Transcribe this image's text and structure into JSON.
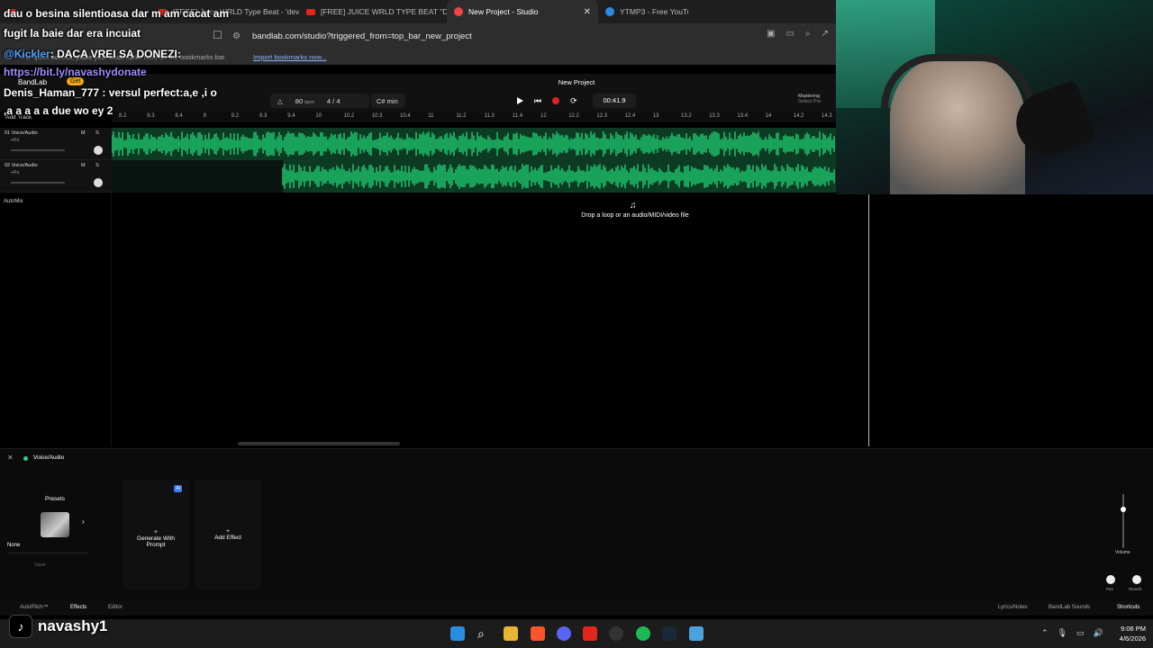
{
  "browser": {
    "tabs": [
      {
        "label": "[FREE] Juice WRLD Type Beat - 'devil",
        "type": "youtube"
      },
      {
        "label": "[FREE] JUICE WRLD TYPE BEAT \"DRUM",
        "type": "youtube"
      },
      {
        "label": "New Project - Studio",
        "type": "bandlab",
        "active": true
      },
      {
        "label": "YTMP3 - Free YouTube",
        "type": "web"
      }
    ],
    "url": "bandlab.com/studio?triggered_from=top_bar_new_project",
    "bookmarks_msg": "For quick access, place your bookmarks here on the bookmarks bar.",
    "import_bookmarks": "Import bookmarks now..."
  },
  "studio": {
    "logo": "BandLab",
    "get_badge": "Get",
    "project_title": "New Project",
    "bpm": "80",
    "bpm_unit": "bpm",
    "time_signature": "4 / 4",
    "key": "C# min",
    "time": "00:41.9",
    "mastering": "Mastering",
    "mastering_sub": "Select Pre",
    "add_track": "Add Track",
    "ruler": [
      "8.2",
      "8.3",
      "8.4",
      "9",
      "9.2",
      "9.3",
      "9.4",
      "10",
      "10.2",
      "10.3",
      "10.4",
      "11",
      "11.2",
      "11.3",
      "11.4",
      "12",
      "12.2",
      "12.3",
      "12.4",
      "13",
      "13.2",
      "13.3",
      "13.4",
      "14",
      "14.2",
      "14.3"
    ],
    "tracks": [
      {
        "name": "01  Voice/Audio",
        "fx": "+Fx",
        "ms": "M S"
      },
      {
        "name": "02  Voice/Audio",
        "fx": "+Fx",
        "ms": "M S"
      }
    ],
    "automix": "AutoMix",
    "drop_hint": "Drop a loop or an audio/MIDI/video file"
  },
  "panel": {
    "title": "Voice/Audio",
    "presets": "Presets",
    "preset_value": "None",
    "save": "Save",
    "generate": "Generate With Prompt",
    "ai_badge": "AI",
    "add_effect": "Add Effect",
    "volume": "Volume",
    "pan": "Pan",
    "reverb": "Reverb"
  },
  "bottom_tabs": {
    "autopitch": "AutoPitch™",
    "effects": "Effects",
    "editor": "Editor",
    "lyrics": "Lyrics/Notes",
    "sounds": "BandLab Sounds",
    "shortcuts": "Shortcuts"
  },
  "taskbar": {
    "time": "9:06 PM",
    "date": "4/6/2026"
  },
  "chat": {
    "line1": "dau o besina silentioasa dar m am cacat am",
    "line2": "fugit la baie dar era incuiat",
    "line3_user": "@Kickler",
    "line3_text": ": DACA VREI SA DONEZI:",
    "line4": "https://bit.ly/navashydonate",
    "line5_user": "Denis_Haman_777",
    "line5_text": " : versul perfect:a,e ,i o",
    "line6": ",a a a a a due wo ey 2"
  },
  "tiktok_handle": "navashy1",
  "colors": {
    "wave_green": "#1fcf73",
    "lane_bg": "#0c3a22",
    "record_red": "#e02020",
    "bandlab_accent": "#f3a712"
  }
}
